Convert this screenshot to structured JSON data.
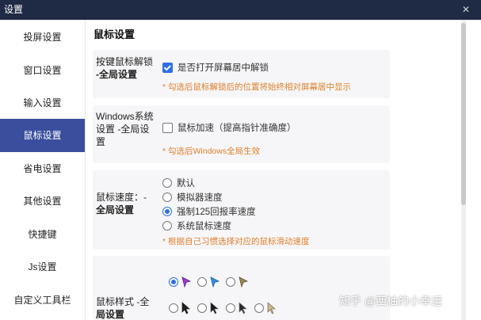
{
  "window": {
    "title": "设置",
    "close_glyph": "✕"
  },
  "sidebar": {
    "items": [
      {
        "label": "投屏设置"
      },
      {
        "label": "窗口设置"
      },
      {
        "label": "输入设置"
      },
      {
        "label": "鼠标设置",
        "active": true
      },
      {
        "label": "省电设置"
      },
      {
        "label": "其他设置"
      },
      {
        "label": "快捷键"
      },
      {
        "label": "Js设置"
      },
      {
        "label": "自定义工具栏"
      }
    ]
  },
  "main": {
    "title": "鼠标设置",
    "unlock": {
      "label_line1": "按键鼠标解锁",
      "label_line2": "-全局设置",
      "checkbox_label": "是否打开屏幕居中解锁",
      "checked": true,
      "hint": "* 勾选后鼠标解锁后的位置将始终相对屏幕居中显示"
    },
    "accel": {
      "label_line1": "Windows系统",
      "label_line2": "设置 -全局设",
      "label_line3": "置",
      "checkbox_label": "鼠标加速（提高指针准确度）",
      "checked": false,
      "hint": "* 勾选后Windows全局生效"
    },
    "speed": {
      "label_line1": "鼠标速度：-",
      "label_line2": "全局设置",
      "options": [
        "默认",
        "模拟器速度",
        "强制125回报率速度",
        "系统鼠标速度"
      ],
      "selected": 2,
      "hint": "* 根据自己习惯选择对应的鼠标滑动速度"
    },
    "style": {
      "label_line1": "鼠标样式 -全",
      "label_line2": "局设置",
      "row1_colors": [
        "#9b3fd1",
        "#2f8fe0",
        "#9a8a5a"
      ],
      "row2_colors": [
        "#222222",
        "#1a1a1a",
        "#2a2a2a",
        "#c8b890"
      ]
    }
  },
  "colors": {
    "titlebar": "#1f2a44",
    "accent": "#3b4e9e",
    "checkbox": "#2f6fe4",
    "hint": "#e07f2a"
  },
  "watermark": "知乎 @西柚的小幸运"
}
